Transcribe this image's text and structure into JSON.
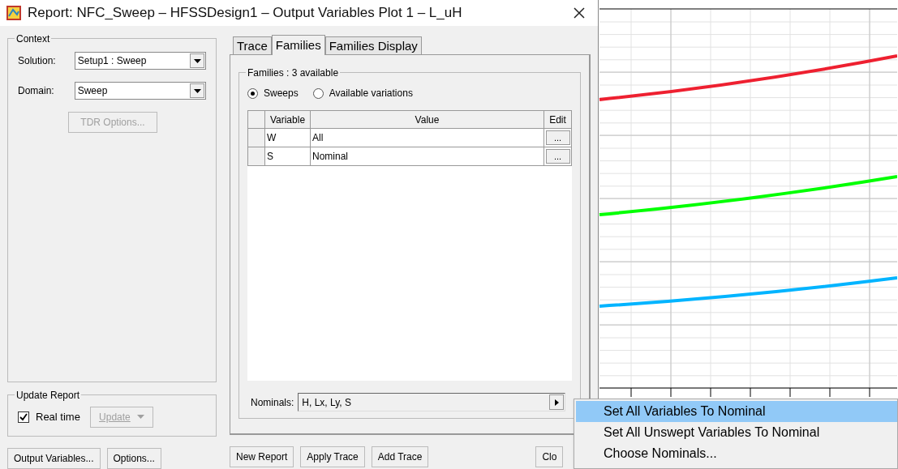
{
  "window": {
    "title": "Report: NFC_Sweep – HFSSDesign1 – Output Variables Plot 1 – L_uH"
  },
  "context": {
    "title": "Context",
    "fields": [
      {
        "label": "Solution:",
        "value": "Setup1 : Sweep"
      },
      {
        "label": "Domain:",
        "value": "Sweep"
      }
    ],
    "tdr_button": {
      "label": "TDR Options...",
      "disabled": true
    }
  },
  "update_report": {
    "title": "Update Report",
    "real_time": {
      "label": "Real time",
      "checked": true
    },
    "update_button": {
      "label": "Update",
      "disabled": true
    }
  },
  "tabs": [
    {
      "label": "Trace",
      "selected": false
    },
    {
      "label": "Families",
      "selected": true
    },
    {
      "label": "Families Display",
      "selected": false
    }
  ],
  "families": {
    "title": "Families : 3 available",
    "modes": [
      {
        "label": "Sweeps",
        "selected": true
      },
      {
        "label": "Available variations",
        "selected": false
      }
    ],
    "table": {
      "columns": [
        "Variable",
        "Value",
        "Edit"
      ],
      "rows": [
        {
          "variable": "W",
          "value": "All",
          "edit": "..."
        },
        {
          "variable": "S",
          "value": "Nominal",
          "edit": "..."
        }
      ]
    },
    "nominals": {
      "label": "Nominals:",
      "value": "H, Lx, Ly, S"
    }
  },
  "left_buttons": [
    "Output Variables...",
    "Options..."
  ],
  "right_buttons": [
    "New Report",
    "Apply Trace",
    "Add Trace",
    "Clo"
  ],
  "context_menu": {
    "items": [
      {
        "label": "Set All Variables To Nominal",
        "selected": true
      },
      {
        "label": "Set All Unswept Variables To Nominal",
        "selected": false
      },
      {
        "label": "Choose Nominals...",
        "selected": false
      }
    ]
  },
  "plot": {
    "kind": "picture"
  }
}
